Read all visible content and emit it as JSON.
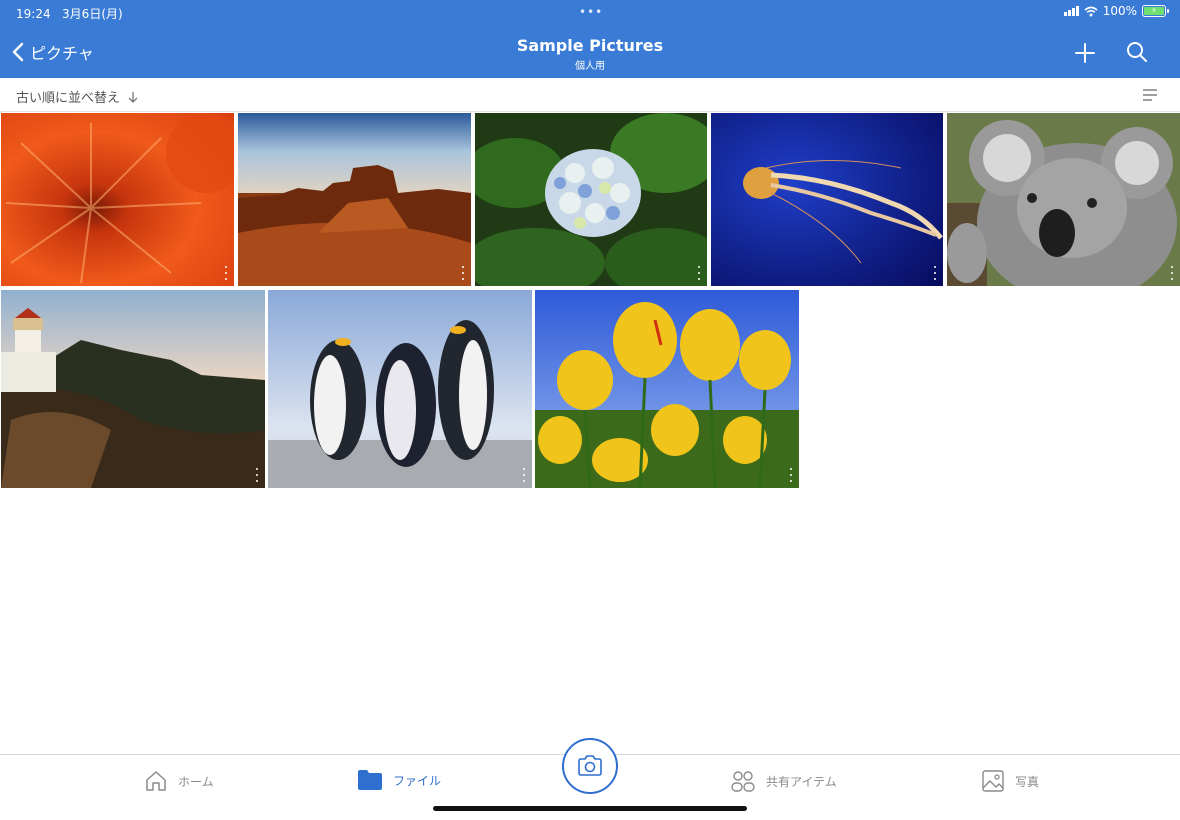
{
  "status_bar": {
    "time": "19:24",
    "date": "3月6日(月)",
    "battery": "100%"
  },
  "nav": {
    "back_label": "ピクチャ",
    "title": "Sample Pictures",
    "subtitle": "個人用"
  },
  "sort": {
    "label": "古い順に並べ替え"
  },
  "photos": [
    {
      "subject": "chrysanthemum"
    },
    {
      "subject": "desert"
    },
    {
      "subject": "hydrangeas"
    },
    {
      "subject": "jellyfish"
    },
    {
      "subject": "koala"
    },
    {
      "subject": "lighthouse"
    },
    {
      "subject": "penguins"
    },
    {
      "subject": "tulips"
    }
  ],
  "tabs": [
    {
      "label": "ホーム",
      "icon": "home-icon",
      "active": false
    },
    {
      "label": "ファイル",
      "icon": "folder-icon",
      "active": true
    },
    {
      "label": "共有アイテム",
      "icon": "shared-icon",
      "active": false
    },
    {
      "label": "写真",
      "icon": "photo-icon",
      "active": false
    }
  ],
  "colors": {
    "accent": "#3a7bd5",
    "tab_active": "#2f6fcf",
    "tab_inactive": "#8a8a8a"
  }
}
